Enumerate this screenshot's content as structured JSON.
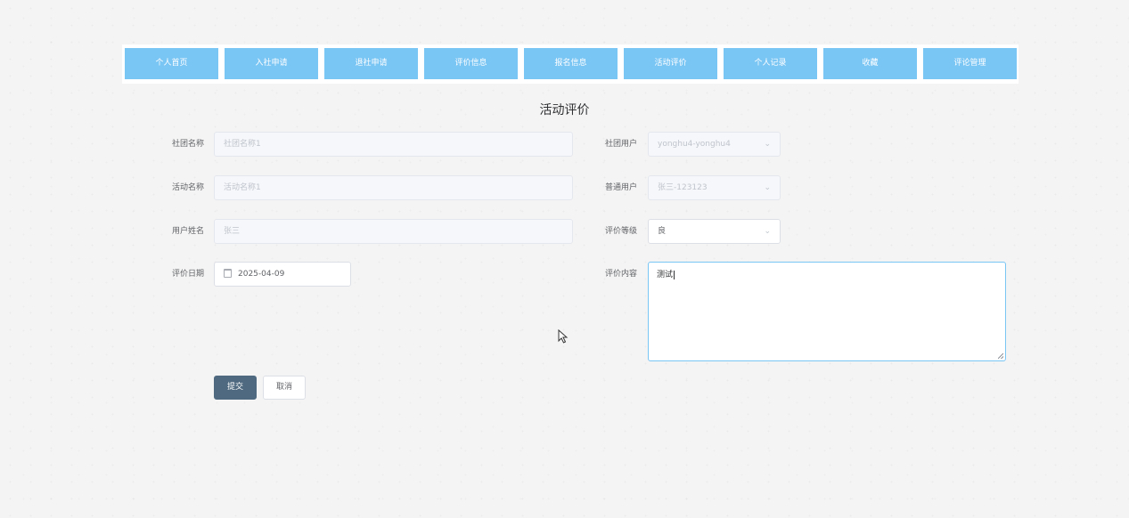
{
  "nav": {
    "items": [
      "个人首页",
      "入社申请",
      "退社申请",
      "评价信息",
      "报名信息",
      "活动评价",
      "个人记录",
      "收藏",
      "评论管理"
    ]
  },
  "page": {
    "title": "活动评价"
  },
  "form": {
    "club_name": {
      "label": "社团名称",
      "placeholder": "社团名称1"
    },
    "club_user": {
      "label": "社团用户",
      "value": "yonghu4-yonghu4"
    },
    "activity_name": {
      "label": "活动名称",
      "placeholder": "活动名称1"
    },
    "normal_user": {
      "label": "普通用户",
      "value": "张三-123123"
    },
    "user_name": {
      "label": "用户姓名",
      "placeholder": "张三"
    },
    "rating": {
      "label": "评价等级",
      "value": "良"
    },
    "review_date": {
      "label": "评价日期",
      "value": "2025-04-09"
    },
    "review_content": {
      "label": "评价内容",
      "value": "测试"
    }
  },
  "buttons": {
    "submit": "提交",
    "cancel": "取消"
  },
  "icons": {
    "select_arrow": "chevron-down-icon",
    "date": "calendar-icon",
    "cursor": "mouse-pointer-icon"
  },
  "colors": {
    "nav_button": "#79c5f4",
    "submit_button": "#4f6a80",
    "focus_border": "#79c5f4"
  }
}
